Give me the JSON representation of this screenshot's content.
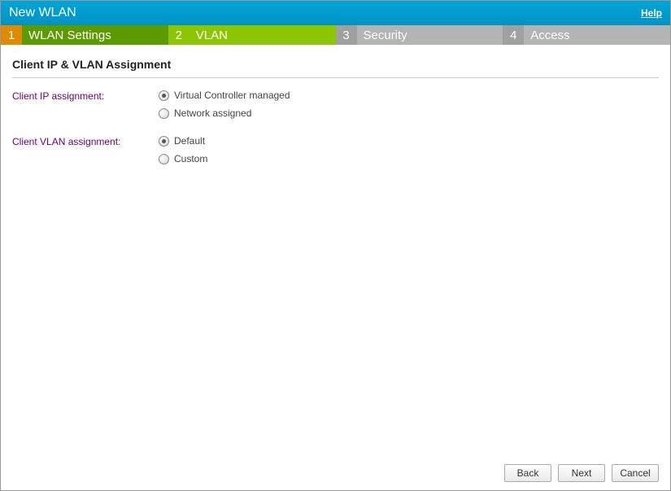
{
  "header": {
    "title": "New WLAN",
    "help": "Help"
  },
  "steps": [
    {
      "num": "1",
      "label": "WLAN Settings",
      "state": "done"
    },
    {
      "num": "2",
      "label": "VLAN",
      "state": "active"
    },
    {
      "num": "3",
      "label": "Security",
      "state": "pending"
    },
    {
      "num": "4",
      "label": "Access",
      "state": "pending"
    }
  ],
  "section_title": "Client IP & VLAN Assignment",
  "fields": {
    "ip_assignment": {
      "label": "Client IP assignment:",
      "options": [
        {
          "label": "Virtual Controller managed",
          "checked": true
        },
        {
          "label": "Network assigned",
          "checked": false
        }
      ]
    },
    "vlan_assignment": {
      "label": "Client VLAN assignment:",
      "options": [
        {
          "label": "Default",
          "checked": true
        },
        {
          "label": "Custom",
          "checked": false
        }
      ]
    }
  },
  "buttons": {
    "back": "Back",
    "next": "Next",
    "cancel": "Cancel"
  }
}
